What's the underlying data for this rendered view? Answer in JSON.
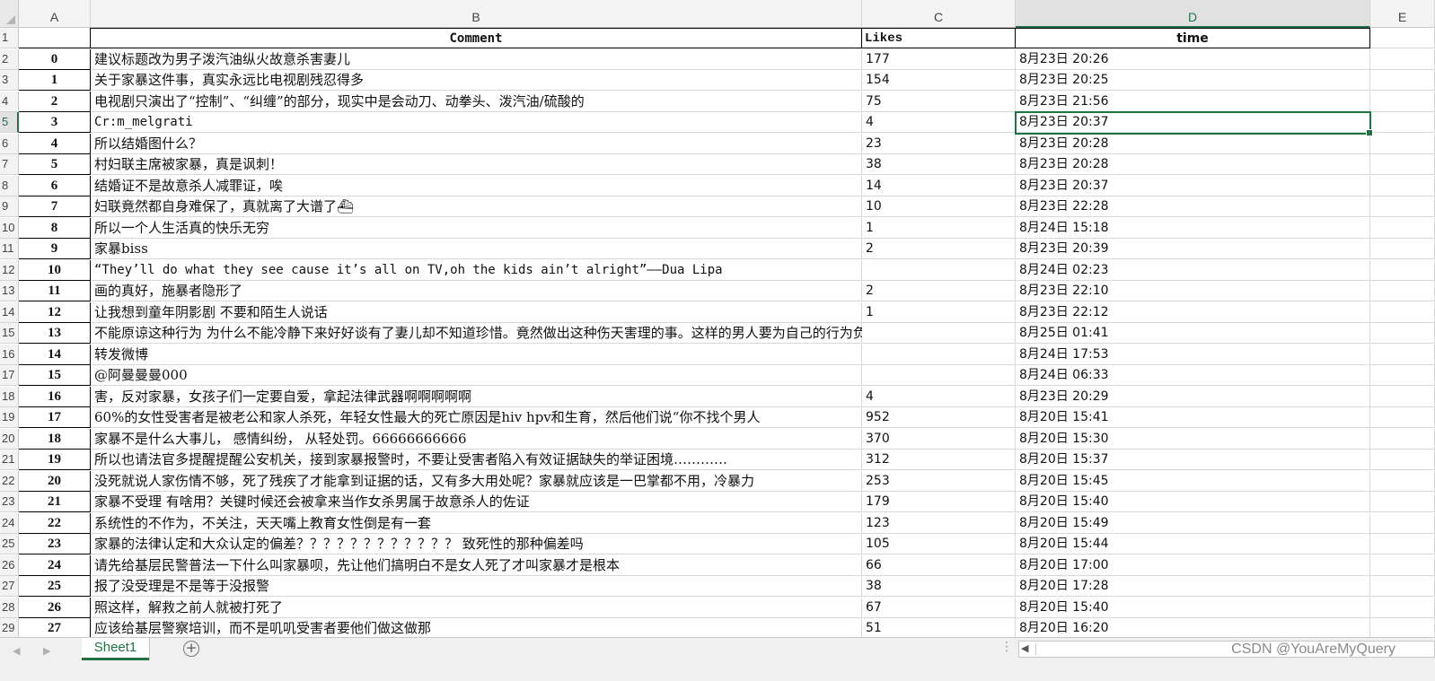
{
  "columns": [
    "A",
    "B",
    "C",
    "D",
    "E"
  ],
  "header_row": {
    "row_number": "1",
    "a": "",
    "b": "Comment",
    "c": "Likes",
    "d": "time"
  },
  "rows": [
    {
      "n": "2",
      "a": "0",
      "b": "建议标题改为男子泼汽油纵火故意杀害妻儿",
      "c": "177",
      "d": "8月23日 20:26"
    },
    {
      "n": "3",
      "a": "1",
      "b": "关于家暴这件事，真实永远比电视剧残忍得多",
      "c": "154",
      "d": "8月23日 20:25"
    },
    {
      "n": "4",
      "a": "2",
      "b": "电视剧只演出了“控制”、“纠缠”的部分，现实中是会动刀、动拳头、泼汽油/硫酸的",
      "c": "75",
      "d": "8月23日 21:56"
    },
    {
      "n": "5",
      "a": "3",
      "b": "Cr:m_melgrati",
      "c": "4",
      "d": "8月23日 20:37"
    },
    {
      "n": "6",
      "a": "4",
      "b": "所以结婚图什么？",
      "c": "23",
      "d": "8月23日 20:28"
    },
    {
      "n": "7",
      "a": "5",
      "b": "村妇联主席被家暴，真是讽刺！",
      "c": "38",
      "d": "8月23日 20:28"
    },
    {
      "n": "8",
      "a": "6",
      "b": "结婚证不是故意杀人减罪证，唉",
      "c": "14",
      "d": "8月23日 20:37"
    },
    {
      "n": "9",
      "a": "7",
      "b": "妇联竟然都自身难保了，真就离了大谱了⛴",
      "c": "10",
      "d": "8月23日 22:28"
    },
    {
      "n": "10",
      "a": "8",
      "b": "所以一个人生活真的快乐无穷",
      "c": "1",
      "d": "8月24日 15:18"
    },
    {
      "n": "11",
      "a": "9",
      "b": "家暴biss",
      "c": "2",
      "d": "8月23日 20:39"
    },
    {
      "n": "12",
      "a": "10",
      "b": "“They’ll do what they see cause it’s all on TV,oh the kids ain’t alright”——Dua Lipa",
      "c": "",
      "d": "8月24日 02:23"
    },
    {
      "n": "13",
      "a": "11",
      "b": "画的真好，施暴者隐形了",
      "c": "2",
      "d": "8月23日 22:10"
    },
    {
      "n": "14",
      "a": "12",
      "b": "让我想到童年阴影剧    不要和陌生人说话",
      "c": "1",
      "d": "8月23日 22:12"
    },
    {
      "n": "15",
      "a": "13",
      "b": "不能原谅这种行为 为什么不能冷静下来好好谈有了妻儿却不知道珍惜。竟然做出这种伤天害理的事。这样的男人要为自己的行为负责",
      "c": "",
      "d": "8月25日 01:41"
    },
    {
      "n": "16",
      "a": "14",
      "b": "转发微博",
      "c": "",
      "d": "8月24日 17:53"
    },
    {
      "n": "17",
      "a": "15",
      "b": "@阿曼曼曼000",
      "c": "",
      "d": "8月24日 06:33"
    },
    {
      "n": "18",
      "a": "16",
      "b": "害，反对家暴，女孩子们一定要自爱，拿起法律武器啊啊啊啊啊",
      "c": "4",
      "d": "8月23日 20:29"
    },
    {
      "n": "19",
      "a": "17",
      "b": "60%的女性受害者是被老公和家人杀死，年轻女性最大的死亡原因是hiv hpv和生育，然后他们说“你不找个男人",
      "c": "952",
      "d": "8月20日 15:41"
    },
    {
      "n": "20",
      "a": "18",
      "b": "家暴不是什么大事儿， 感情纠纷， 从轻处罚。66666666666",
      "c": "370",
      "d": "8月20日 15:30"
    },
    {
      "n": "21",
      "a": "19",
      "b": "所以也请法官多提醒提醒公安机关，接到家暴报警时，不要让受害者陷入有效证据缺失的举证困境…………",
      "c": "312",
      "d": "8月20日 15:37"
    },
    {
      "n": "22",
      "a": "20",
      "b": "没死就说人家伤情不够，死了残疾了才能拿到证据的话，又有多大用处呢？家暴就应该是一巴掌都不用，冷暴力",
      "c": "253",
      "d": "8月20日 15:45"
    },
    {
      "n": "23",
      "a": "21",
      "b": "家暴不受理  有啥用？关键时候还会被拿来当作女杀男属于故意杀人的佐证",
      "c": "179",
      "d": "8月20日 15:40"
    },
    {
      "n": "24",
      "a": "22",
      "b": "系统性的不作为，不关注，天天嘴上教育女性倒是有一套",
      "c": "123",
      "d": "8月20日 15:49"
    },
    {
      "n": "25",
      "a": "23",
      "b": "家暴的法律认定和大众认定的偏差？？？？？？？？？？？？ 致死性的那种偏差吗",
      "c": "105",
      "d": "8月20日 15:44"
    },
    {
      "n": "26",
      "a": "24",
      "b": "请先给基层民警普法一下什么叫家暴呗，先让他们搞明白不是女人死了才叫家暴才是根本",
      "c": "66",
      "d": "8月20日 17:00"
    },
    {
      "n": "27",
      "a": "25",
      "b": "报了没受理是不是等于没报警",
      "c": "38",
      "d": "8月20日 17:28"
    },
    {
      "n": "28",
      "a": "26",
      "b": "照这样，解救之前人就被打死了",
      "c": "67",
      "d": "8月20日 15:40"
    },
    {
      "n": "29",
      "a": "27",
      "b": "应该给基层警察培训，而不是叽叽受害者要他们做这做那",
      "c": "51",
      "d": "8月20日 16:20"
    }
  ],
  "active_cell": {
    "column": "D",
    "row": "5"
  },
  "sheet_tab": "Sheet1",
  "add_sheet_icon": "plus-circle-icon",
  "watermark": "CSDN @YouAreMyQuery",
  "accent_color": "#217346"
}
